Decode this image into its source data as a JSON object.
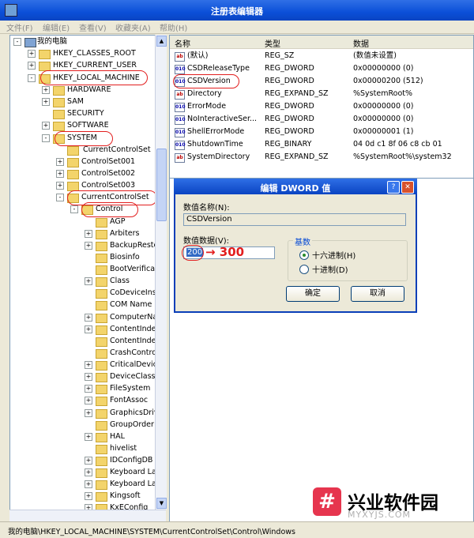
{
  "window": {
    "title": "注册表编辑器"
  },
  "menu": [
    "文件(F)",
    "编辑(E)",
    "查看(V)",
    "收藏夹(A)",
    "帮助(H)"
  ],
  "tree": [
    {
      "label": "我的电脑",
      "exp": "-",
      "icon": "computer"
    },
    {
      "label": "HKEY_CLASSES_ROOT",
      "exp": "+"
    },
    {
      "label": "HKEY_CURRENT_USER",
      "exp": "+"
    },
    {
      "label": "HKEY_LOCAL_MACHINE",
      "exp": "-"
    },
    {
      "label": "HARDWARE",
      "exp": "+"
    },
    {
      "label": "SAM",
      "exp": "+"
    },
    {
      "label": "SECURITY",
      "exp": ""
    },
    {
      "label": "SOFTWARE",
      "exp": "+"
    },
    {
      "label": "SYSTEM",
      "exp": "-"
    },
    {
      "label": "CurrentControlSet",
      "exp": ""
    },
    {
      "label": "ControlSet001",
      "exp": "+"
    },
    {
      "label": "ControlSet002",
      "exp": "+"
    },
    {
      "label": "ControlSet003",
      "exp": "+"
    },
    {
      "label": "CurrentControlSet",
      "exp": "-"
    },
    {
      "label": "Control",
      "exp": "-"
    },
    {
      "label": "AGP",
      "exp": ""
    },
    {
      "label": "Arbiters",
      "exp": "+"
    },
    {
      "label": "BackupReste",
      "exp": "+"
    },
    {
      "label": "Biosinfo",
      "exp": ""
    },
    {
      "label": "BootVerifica",
      "exp": ""
    },
    {
      "label": "Class",
      "exp": "+"
    },
    {
      "label": "CoDeviceIns",
      "exp": ""
    },
    {
      "label": "COM Name",
      "exp": ""
    },
    {
      "label": "ComputerNa",
      "exp": "+"
    },
    {
      "label": "ContentInde",
      "exp": "+"
    },
    {
      "label": "ContentInde",
      "exp": ""
    },
    {
      "label": "CrashContro",
      "exp": ""
    },
    {
      "label": "CriticalDevic",
      "exp": "+"
    },
    {
      "label": "DeviceClass",
      "exp": "+"
    },
    {
      "label": "FileSystem",
      "exp": "+"
    },
    {
      "label": "FontAssoc",
      "exp": "+"
    },
    {
      "label": "GraphicsDriv",
      "exp": "+"
    },
    {
      "label": "GroupOrder",
      "exp": ""
    },
    {
      "label": "HAL",
      "exp": "+"
    },
    {
      "label": "hivelist",
      "exp": ""
    },
    {
      "label": "IDConfigDB",
      "exp": "+"
    },
    {
      "label": "Keyboard La",
      "exp": "+"
    },
    {
      "label": "Keyboard La",
      "exp": "+"
    },
    {
      "label": "Kingsoft",
      "exp": "+"
    },
    {
      "label": "KxEConfig",
      "exp": "+"
    }
  ],
  "list": {
    "headers": [
      "名称",
      "类型",
      "数据"
    ],
    "rows": [
      {
        "icon": "ab",
        "name": "(默认)",
        "type": "REG_SZ",
        "data": "(数值未设置)"
      },
      {
        "icon": "010",
        "name": "CSDReleaseType",
        "type": "REG_DWORD",
        "data": "0x00000000 (0)"
      },
      {
        "icon": "010",
        "name": "CSDVersion",
        "type": "REG_DWORD",
        "data": "0x00000200 (512)"
      },
      {
        "icon": "ab",
        "name": "Directory",
        "type": "REG_EXPAND_SZ",
        "data": "%SystemRoot%"
      },
      {
        "icon": "010",
        "name": "ErrorMode",
        "type": "REG_DWORD",
        "data": "0x00000000 (0)"
      },
      {
        "icon": "010",
        "name": "NoInteractiveSer...",
        "type": "REG_DWORD",
        "data": "0x00000000 (0)"
      },
      {
        "icon": "010",
        "name": "ShellErrorMode",
        "type": "REG_DWORD",
        "data": "0x00000001 (1)"
      },
      {
        "icon": "010",
        "name": "ShutdownTime",
        "type": "REG_BINARY",
        "data": "04 0d c1 8f 06 c8 cb 01"
      },
      {
        "icon": "ab",
        "name": "SystemDirectory",
        "type": "REG_EXPAND_SZ",
        "data": "%SystemRoot%\\system32"
      }
    ]
  },
  "dialog": {
    "title": "编辑 DWORD 值",
    "help": "?",
    "close": "✕",
    "name_label": "数值名称(N):",
    "name_value": "CSDVersion",
    "data_label": "数值数据(V):",
    "data_value": "200",
    "base_label": "基数",
    "hex_label": "十六进制(H)",
    "dec_label": "十进制(D)",
    "ok": "确定",
    "cancel": "取消",
    "annotation": "→ 300"
  },
  "status": "我的电脑\\HKEY_LOCAL_MACHINE\\SYSTEM\\CurrentControlSet\\Control\\Windows",
  "watermark": {
    "glyph": "#",
    "name": "兴业软件园",
    "url": "MYXYJS.COM"
  },
  "colors": {
    "title_bar": "#0b4fd8",
    "annotation": "#e21e1e",
    "watermark_icon": "#e6354e"
  }
}
